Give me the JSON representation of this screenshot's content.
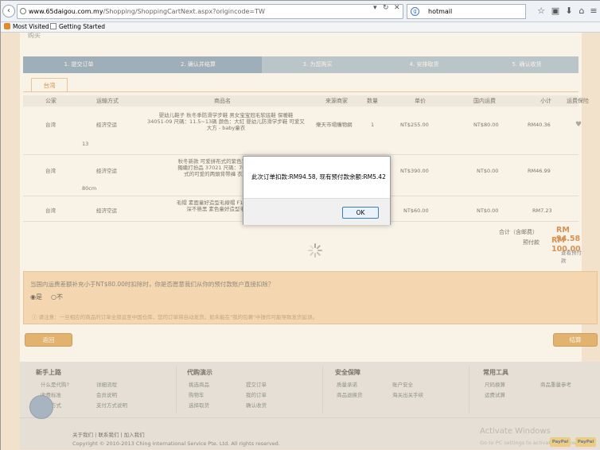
{
  "browser": {
    "url_host": "www.65daigou.com.my",
    "url_path": "/Shopping/ShoppingCartNext.aspx?origincode=TW",
    "search_value": "hotmail",
    "bookmarks": [
      "Most Visited",
      "Getting Started"
    ]
  },
  "page": {
    "header_fragment": "购买",
    "steps": [
      "1. 提交订单",
      "2. 确认并结算",
      "3. 为您购买",
      "4. 安排取货",
      "5. 确认收货"
    ],
    "country_tab": "台湾",
    "table_headers": [
      "公家",
      "运输方式",
      "商品名",
      "来源商家",
      "数量",
      "单价",
      "国内运费",
      "小计",
      "运费保险"
    ],
    "rows": [
      {
        "country": "台湾",
        "shipping": "经济空运",
        "desc": [
          "婴幼儿鞋子 秋冬季防滑学步鞋 男女宝宝冠毛软底鞋 保暖鞋",
          "34051-09 尺碼：11.5~13碼 颜色：大紅 婴幼儿防滑学步鞋 可爱又",
          "大方 - baby童衣"
        ],
        "extra": "13",
        "seller": "樂天市場購物網",
        "qty": "1",
        "price": "NT$255.00",
        "domestic": "NT$80.00",
        "subtotal": "RM40.36"
      },
      {
        "country": "台湾",
        "shipping": "经济空运",
        "desc": [
          "秋冬新款 可爱拼布式的紫色背帶褲 搭配...",
          "獨繼打扮品 37021 尺碼：70~80cm顏...",
          "式的可爱的两頭背帶褲 衣服圓潤等..."
        ],
        "extra": "80cm",
        "seller": "",
        "qty": "",
        "price": "NT$390.00",
        "domestic": "NT$0.00",
        "subtotal": "RM46.99"
      },
      {
        "country": "台湾",
        "shipping": "经济空运",
        "desc": [
          "毛帽 素面童好造型毛線帽 F1060 [藍/黑]...",
          "深不懸黑 素色童好造型毛線時尚..."
        ],
        "extra": "",
        "seller": "",
        "qty": "",
        "price": "NT$60.00",
        "domestic": "NT$0.00",
        "subtotal": "RM7.23"
      }
    ],
    "total_label": "合计（含邮费）",
    "total_value": "RM 94.58",
    "prepaid_label": "预付款",
    "prepaid_value": "RM 100.00",
    "view_prepaid": "查看预付款",
    "balance_question": "当国内运费差额补充小于NT$80.00时扣除时，你是否愿意我们从你的预付款账户直接扣除？",
    "radio_yes": "是",
    "radio_no": "不",
    "note": "请注意：一旦相应的商品的订单全部运至中国仓库，您的订单将自动发货。如未能在\"我的包裹\"中操作可能导致发货延误。",
    "back_button": "返回",
    "checkout_button": "结算"
  },
  "footer": {
    "columns": [
      {
        "title": "新手上路",
        "links": [
          "什么是代购?",
          "收费标准",
          "取货方式",
          "详细流程",
          "会员说明",
          "支付方式说明"
        ]
      },
      {
        "title": "代购演示",
        "links": [
          "挑选商品",
          "购物车",
          "选择取货",
          "提交订单",
          "我的订单",
          "确认收货"
        ]
      },
      {
        "title": "安全保障",
        "links": [
          "质量承诺",
          "商品退换货",
          "账户安全",
          "海关出关手续"
        ]
      },
      {
        "title": "常用工具",
        "links": [
          "尺码换算",
          "运费试算",
          "商品重量参考"
        ]
      }
    ],
    "about": "关于我们 | 联系我们 | 加入我们",
    "copyright": "Copyright © 2010-2013 Ching International Service Pte. Ltd. All rights reserved.",
    "activate_title": "Activate Windows",
    "activate_sub": "Go to PC settings to activate Windows.",
    "paypal": [
      "PayPal",
      "PayPal"
    ]
  },
  "dialog": {
    "message": "此次订单扣款:RM94.58, 现有预付款余额:RM5.42",
    "ok_label": "OK"
  }
}
